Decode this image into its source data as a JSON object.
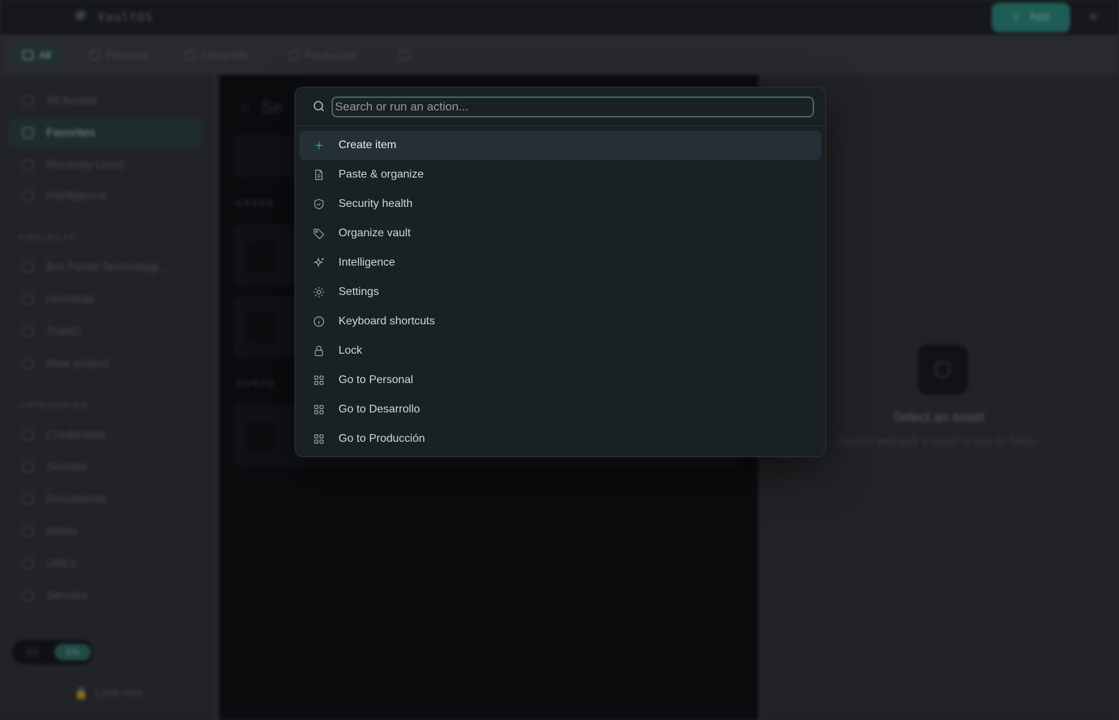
{
  "app": {
    "name": "VaultOS",
    "add_label": "Add"
  },
  "tabs": [
    {
      "label": "All"
    },
    {
      "label": "Personal"
    },
    {
      "label": "Desarrollo"
    },
    {
      "label": "Producción"
    }
  ],
  "sidebar": {
    "items": [
      {
        "label": "All Assets"
      },
      {
        "label": "Favorites"
      },
      {
        "label": "Recently Used"
      },
      {
        "label": "Intelligence"
      }
    ],
    "projects_heading": "PROJECTS",
    "projects": [
      {
        "label": "Bot Portal Technologi..."
      },
      {
        "label": "Homelab"
      },
      {
        "label": "TrainD"
      },
      {
        "label": "New project"
      }
    ],
    "categories_heading": "CATEGORIES",
    "categories": [
      {
        "label": "Credentials"
      },
      {
        "label": "Secrets"
      },
      {
        "label": "Documents"
      },
      {
        "label": "Notes"
      },
      {
        "label": "URLs"
      },
      {
        "label": "Servers"
      }
    ],
    "lang_es": "ES",
    "lang_en": "EN",
    "lock_now": "Lock now"
  },
  "main": {
    "search_text": "Se",
    "section_credentials": "CREDE",
    "section_custom": "CUSTO"
  },
  "detail": {
    "title": "Select an asset",
    "subtitle": "Search and pick a result to see its fields."
  },
  "palette": {
    "placeholder": "Search or run an action...",
    "items": [
      {
        "label": "Create item",
        "icon": "plus-icon"
      },
      {
        "label": "Paste & organize",
        "icon": "document-icon"
      },
      {
        "label": "Security health",
        "icon": "shield-icon"
      },
      {
        "label": "Organize vault",
        "icon": "tag-icon"
      },
      {
        "label": "Intelligence",
        "icon": "sparkle-icon"
      },
      {
        "label": "Settings",
        "icon": "sun-icon"
      },
      {
        "label": "Keyboard shortcuts",
        "icon": "info-icon"
      },
      {
        "label": "Lock",
        "icon": "lock-icon"
      },
      {
        "label": "Go to Personal",
        "icon": "grid-icon"
      },
      {
        "label": "Go to Desarrollo",
        "icon": "grid-icon"
      },
      {
        "label": "Go to Producción",
        "icon": "grid-icon"
      }
    ]
  },
  "colors": {
    "accent": "#2a8a7e",
    "palette_bg": "#1a2125",
    "selected_bg": "#243036"
  }
}
